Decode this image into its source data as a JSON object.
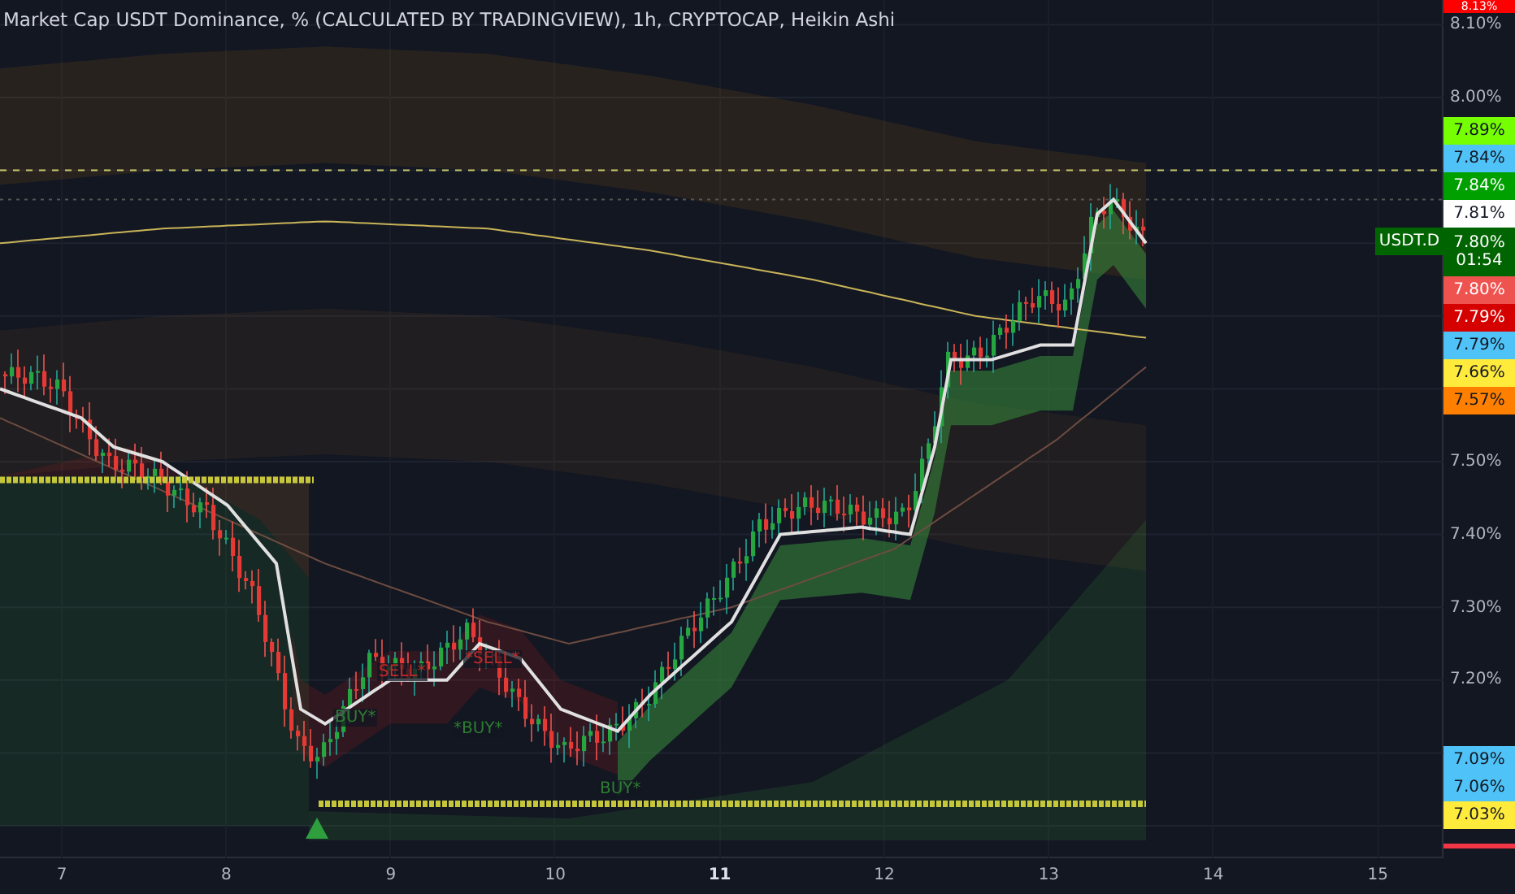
{
  "title": "Market Cap USDT Dominance, % (CALCULATED BY TRADINGVIEW), 1h, CRYPTOCAP, Heikin Ashi",
  "price_axis": [
    "8.10%",
    "8.00%",
    "7.50%",
    "7.40%",
    "7.30%",
    "7.20%"
  ],
  "top_tag": {
    "text": "8.13%",
    "color": "#ff0000"
  },
  "price_tags_upper": [
    {
      "kind": "tag",
      "text": "7.89%",
      "color": "#76ff03"
    },
    {
      "kind": "tag",
      "text": "7.84%",
      "color": "#4fc3f7"
    },
    {
      "kind": "tag",
      "text": "7.84%",
      "color": "#00a000"
    },
    {
      "kind": "tag",
      "text": "7.81%",
      "color": "#ffffff"
    },
    {
      "kind": "current",
      "symbol": "USDT.D",
      "text": "7.80%",
      "countdown": "01:54",
      "color": "#006400"
    },
    {
      "kind": "tag",
      "text": "7.80%",
      "color": "#ef5350"
    },
    {
      "kind": "tag",
      "text": "7.79%",
      "color": "#d50000"
    },
    {
      "kind": "tag",
      "text": "7.79%",
      "color": "#4fc3f7"
    },
    {
      "kind": "tag",
      "text": "7.66%",
      "color": "#ffeb3b"
    },
    {
      "kind": "tag",
      "text": "7.57%",
      "color": "#ff8000"
    }
  ],
  "price_tags_lower": [
    {
      "kind": "tag",
      "text": "7.09%",
      "color": "#4fc3f7"
    },
    {
      "kind": "tag",
      "text": "7.06%",
      "color": "#4fc3f7"
    },
    {
      "kind": "tag",
      "text": "7.03%",
      "color": "#ffeb3b"
    }
  ],
  "time_axis": [
    {
      "text": "7",
      "bold": false
    },
    {
      "text": "8",
      "bold": false
    },
    {
      "text": "9",
      "bold": false
    },
    {
      "text": "10",
      "bold": false
    },
    {
      "text": "11",
      "bold": true
    },
    {
      "text": "12",
      "bold": false
    },
    {
      "text": "13",
      "bold": false
    },
    {
      "text": "14",
      "bold": false
    },
    {
      "text": "15",
      "bold": false
    }
  ],
  "signals": [
    {
      "kind": "buy",
      "text": "BUY*"
    },
    {
      "kind": "sell",
      "text": "SELL*"
    },
    {
      "kind": "sell",
      "text": "*SELL*"
    },
    {
      "kind": "buy",
      "text": "*BUY*"
    },
    {
      "kind": "buy",
      "text": "BUY*"
    }
  ]
}
